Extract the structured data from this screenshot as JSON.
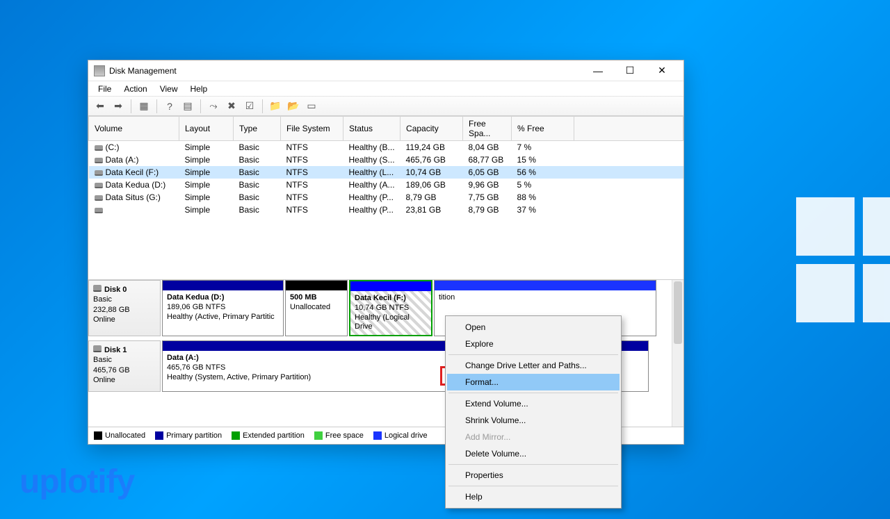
{
  "watermark": "uplotify",
  "window": {
    "title": "Disk Management",
    "menus": [
      "File",
      "Action",
      "View",
      "Help"
    ],
    "controls": {
      "min": "—",
      "max": "☐",
      "close": "✕"
    }
  },
  "columns": [
    "Volume",
    "Layout",
    "Type",
    "File System",
    "Status",
    "Capacity",
    "Free Spa...",
    "% Free"
  ],
  "volumes": [
    {
      "name": "(C:)",
      "layout": "Simple",
      "type": "Basic",
      "fs": "NTFS",
      "status": "Healthy (B...",
      "capacity": "119,24 GB",
      "free": "8,04 GB",
      "pct": "7 %",
      "selected": false
    },
    {
      "name": "Data (A:)",
      "layout": "Simple",
      "type": "Basic",
      "fs": "NTFS",
      "status": "Healthy (S...",
      "capacity": "465,76 GB",
      "free": "68,77 GB",
      "pct": "15 %",
      "selected": false
    },
    {
      "name": "Data Kecil (F:)",
      "layout": "Simple",
      "type": "Basic",
      "fs": "NTFS",
      "status": "Healthy (L...",
      "capacity": "10,74 GB",
      "free": "6,05 GB",
      "pct": "56 %",
      "selected": true
    },
    {
      "name": "Data Kedua (D:)",
      "layout": "Simple",
      "type": "Basic",
      "fs": "NTFS",
      "status": "Healthy (A...",
      "capacity": "189,06 GB",
      "free": "9,96 GB",
      "pct": "5 %",
      "selected": false
    },
    {
      "name": "Data Situs (G:)",
      "layout": "Simple",
      "type": "Basic",
      "fs": "NTFS",
      "status": "Healthy (P...",
      "capacity": "8,79 GB",
      "free": "7,75 GB",
      "pct": "88 %",
      "selected": false
    },
    {
      "name": "",
      "layout": "Simple",
      "type": "Basic",
      "fs": "NTFS",
      "status": "Healthy (P...",
      "capacity": "23,81 GB",
      "free": "8,79 GB",
      "pct": "37 %",
      "selected": false
    }
  ],
  "disks": [
    {
      "name": "Disk 0",
      "type": "Basic",
      "size": "232,88 GB",
      "status": "Online",
      "parts": [
        {
          "kind": "primary",
          "title": "Data Kedua  (D:)",
          "line2": "189,06 GB NTFS",
          "line3": "Healthy (Active, Primary Partitic",
          "flex": 175
        },
        {
          "kind": "unalloc",
          "title": "500 MB",
          "line2": "Unallocated",
          "line3": "",
          "flex": 90
        },
        {
          "kind": "selected",
          "title": "Data Kecil  (F:)",
          "line2": "10,74 GB NTFS",
          "line3": "Healthy (Logical Drive",
          "flex": 120
        },
        {
          "kind": "logical",
          "title": "",
          "line2": "",
          "line3": "tition",
          "flex": 320
        }
      ]
    },
    {
      "name": "Disk 1",
      "type": "Basic",
      "size": "465,76 GB",
      "status": "Online",
      "parts": [
        {
          "kind": "primary",
          "title": "Data  (A:)",
          "line2": "465,76 GB NTFS",
          "line3": "Healthy (System, Active, Primary Partition)",
          "flex": 700
        }
      ]
    }
  ],
  "legend": {
    "unallocated": "Unallocated",
    "primary": "Primary partition",
    "extended": "Extended partition",
    "free": "Free space",
    "logical": "Logical drive"
  },
  "context_menu": {
    "open": "Open",
    "explore": "Explore",
    "change": "Change Drive Letter and Paths...",
    "format": "Format...",
    "extend": "Extend Volume...",
    "shrink": "Shrink Volume...",
    "mirror": "Add Mirror...",
    "delete": "Delete Volume...",
    "properties": "Properties",
    "help": "Help"
  }
}
